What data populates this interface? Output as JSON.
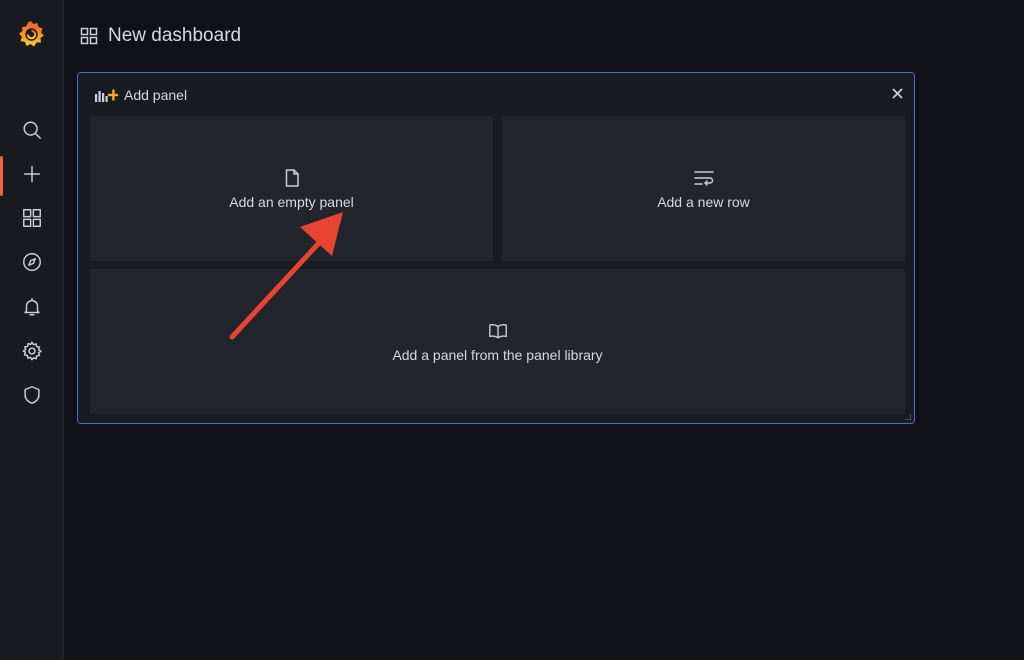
{
  "header": {
    "title": "New dashboard"
  },
  "sidebar": {
    "items": [
      {
        "icon": "search-icon"
      },
      {
        "icon": "plus-icon",
        "active": true
      },
      {
        "icon": "dashboards-icon"
      },
      {
        "icon": "compass-icon"
      },
      {
        "icon": "bell-icon"
      },
      {
        "icon": "gear-icon"
      },
      {
        "icon": "shield-icon"
      }
    ]
  },
  "panel": {
    "title": "Add panel",
    "options": {
      "empty": "Add an empty panel",
      "row": "Add a new row",
      "library": "Add a panel from the panel library"
    }
  },
  "colors": {
    "accent": "#f55f3e",
    "border": "#3d71d9",
    "annotation_arrow": "#e94332"
  }
}
